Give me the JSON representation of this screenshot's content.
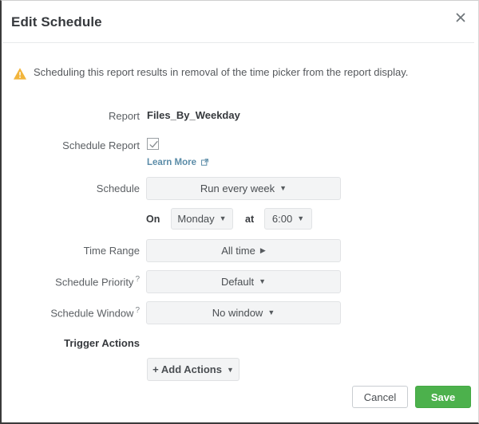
{
  "dialog": {
    "title": "Edit Schedule",
    "close_icon": "close-icon",
    "warning": {
      "icon": "warning-triangle-icon",
      "text": "Scheduling this report results in removal of the time picker from the report display."
    }
  },
  "form": {
    "report": {
      "label": "Report",
      "value": "Files_By_Weekday"
    },
    "schedule_report": {
      "label": "Schedule Report",
      "checked": true,
      "link_text": "Learn More",
      "link_icon": "external-link-icon"
    },
    "schedule": {
      "label": "Schedule",
      "value": "Run every week",
      "on_word": "On",
      "day_value": "Monday",
      "at_word": "at",
      "time_value": "6:00"
    },
    "time_range": {
      "label": "Time Range",
      "value": "All time"
    },
    "schedule_priority": {
      "label": "Schedule Priority",
      "help": "?",
      "value": "Default"
    },
    "schedule_window": {
      "label": "Schedule Window",
      "help": "?",
      "value": "No window"
    },
    "trigger_actions": {
      "label": "Trigger Actions",
      "add_button": "+ Add Actions"
    }
  },
  "footer": {
    "cancel_label": "Cancel",
    "save_label": "Save"
  },
  "colors": {
    "save_green": "#4cb14c",
    "warning_amber": "#f2b53c",
    "link_blue": "#5b8ca8",
    "title_text": "#36393d"
  }
}
